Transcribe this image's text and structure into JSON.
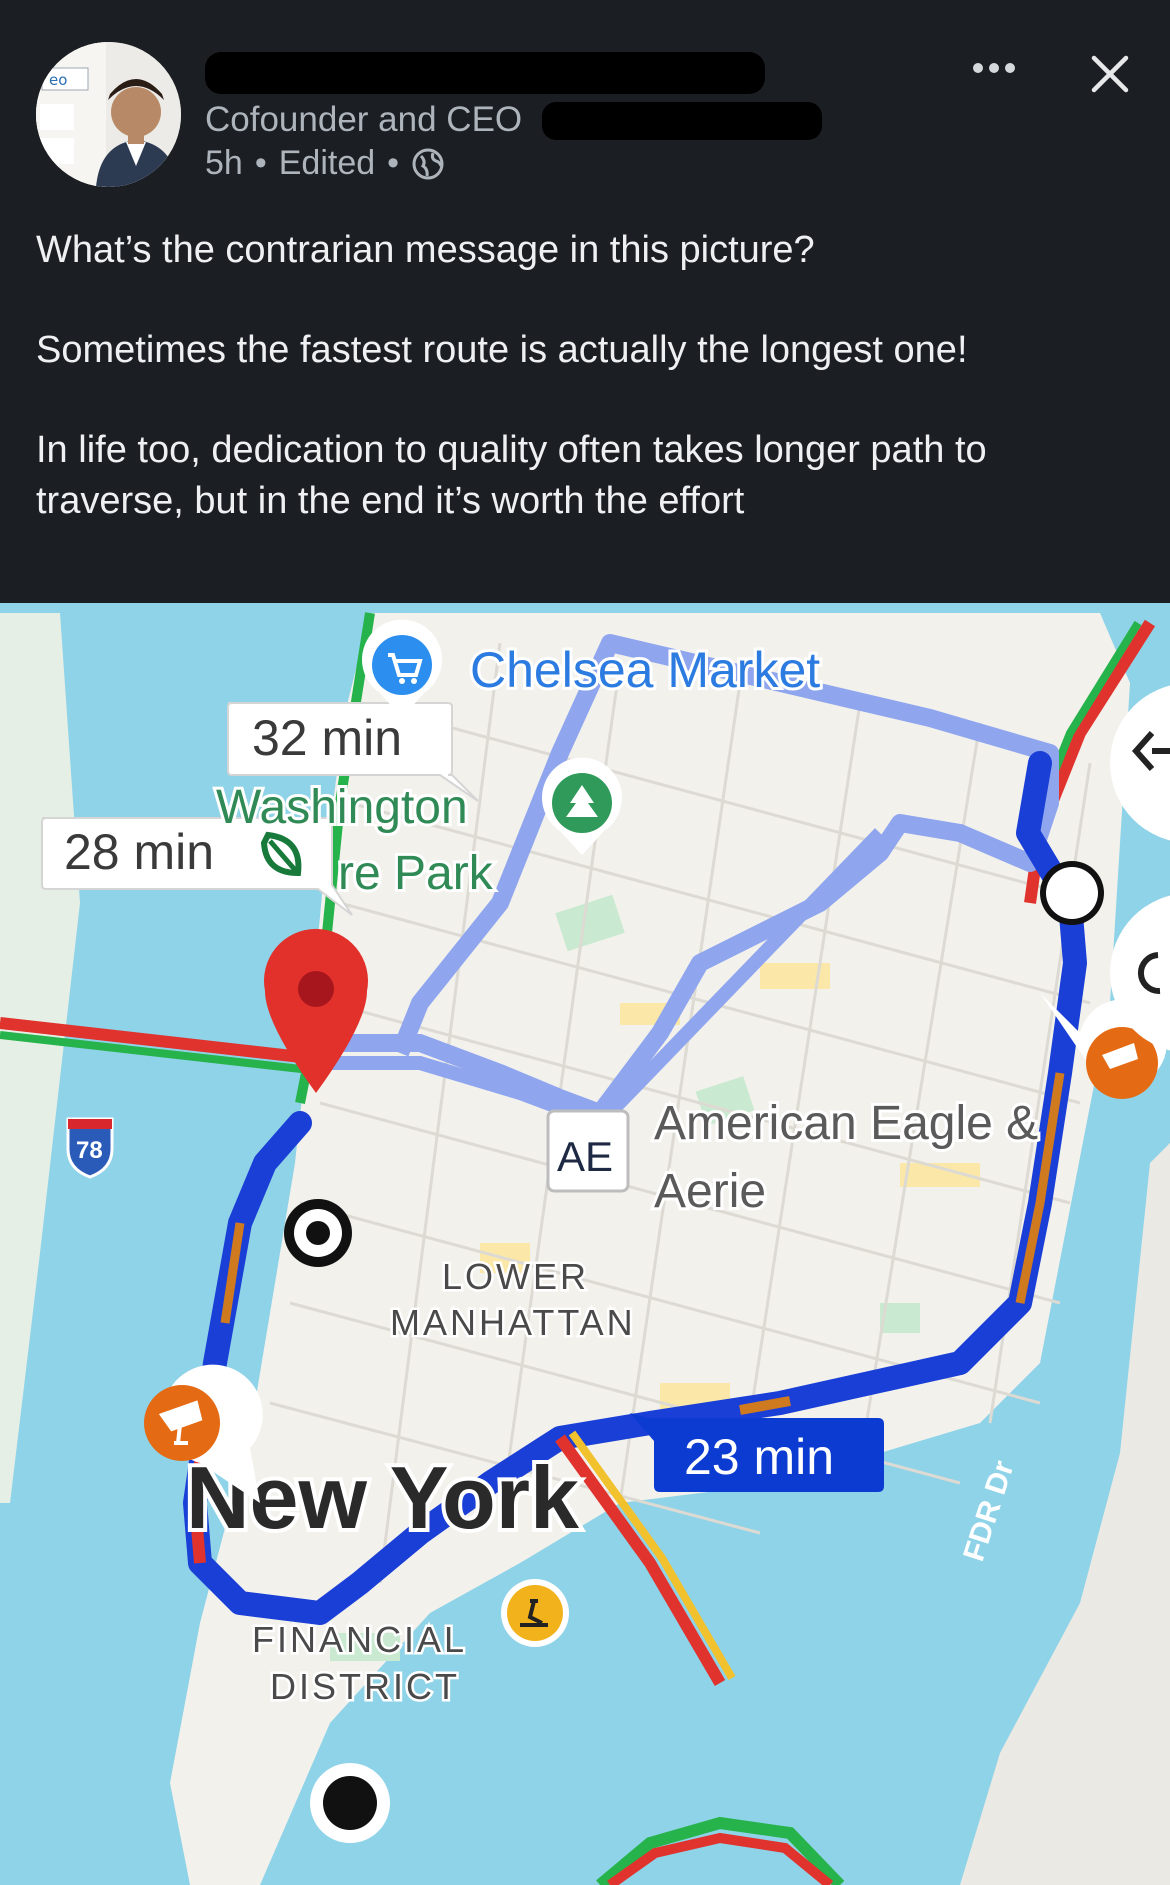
{
  "post": {
    "author_subtitle": "Cofounder and CEO",
    "time": "5h",
    "edited": "Edited",
    "separator": "•",
    "body": [
      "What’s the contrarian message in this picture?",
      "Sometimes the fastest route is actually the longest one!",
      "In life too, dedication to quality often takes longer path to traverse, but in the end it’s worth the effort"
    ],
    "more_icon": "more-dots-icon",
    "close_icon": "close-icon",
    "visibility_icon": "globe-icon"
  },
  "map": {
    "places": {
      "chelsea_market": "Chelsea Market",
      "washington": "Washington",
      "square_park": "re Park",
      "ae_badge": "AE",
      "american_eagle_1": "American Eagle &",
      "american_eagle_2": "Aerie",
      "lower_1": "LOWER",
      "lower_2": "MANHATTAN",
      "city": "New York",
      "financial_1": "FINANCIAL",
      "financial_2": "DISTRICT",
      "road_fdr": "FDR Dr",
      "highway_shield": "78"
    },
    "routes": {
      "alt_1_time": "32 min",
      "alt_2_time": "28 min",
      "main_time": "23 min"
    },
    "colors": {
      "water": "#8fd3e8",
      "land": "#f3f1ec",
      "park": "#c9ead0",
      "main_route": "#1a3fd6",
      "alt_route": "#8fa6ef",
      "traffic_red": "#e0332d",
      "traffic_green": "#27b34b",
      "traffic_orange": "#d07a1f",
      "traffic_yellow": "#f2c12e",
      "pin_red": "#e2312b"
    }
  }
}
